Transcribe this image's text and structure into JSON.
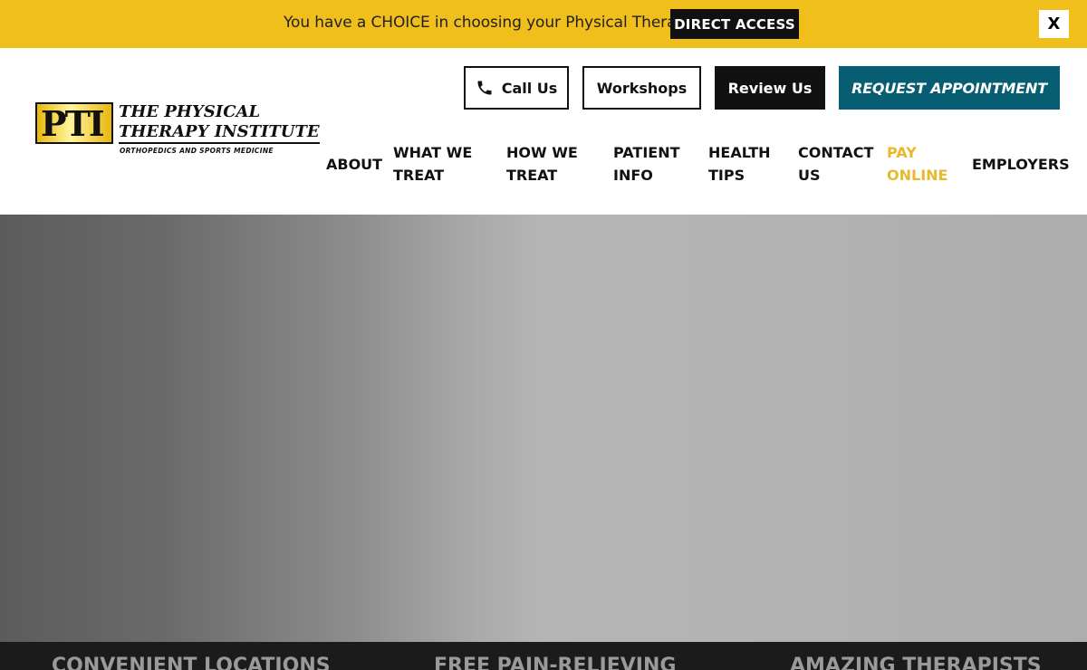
{
  "announcement": {
    "text": "You have a CHOICE in choosing your Physical Therapist",
    "button_label": "DIRECT ACCESS",
    "close_label": "X"
  },
  "logo": {
    "letters": "PTI",
    "line1": "THE PHYSICAL",
    "line2": "THERAPY INSTITUTE",
    "line3": "ORTHOPEDICS AND SPORTS MEDICINE"
  },
  "header_buttons": {
    "call": "Call Us",
    "workshops": "Workshops",
    "review": "Review Us",
    "request": "REQUEST APPOINTMENT"
  },
  "nav": [
    {
      "line1": "ABOUT",
      "line2": ""
    },
    {
      "line1": "WHAT WE",
      "line2": "TREAT"
    },
    {
      "line1": "HOW WE",
      "line2": "TREAT"
    },
    {
      "line1": "PATIENT",
      "line2": "INFO"
    },
    {
      "line1": "HEALTH",
      "line2": "TIPS"
    },
    {
      "line1": "CONTACT",
      "line2": "US"
    },
    {
      "line1": "PAY",
      "line2": "ONLINE"
    },
    {
      "line1": "EMPLOYERS",
      "line2": ""
    }
  ],
  "features": [
    "CONVENIENT LOCATIONS",
    "FREE PAIN-RELIEVING",
    "AMAZING THERAPISTS"
  ],
  "colors": {
    "announcement_bg": "#f0bf1c",
    "request_bg": "#075d72",
    "pay_online": "#e8b92c"
  }
}
